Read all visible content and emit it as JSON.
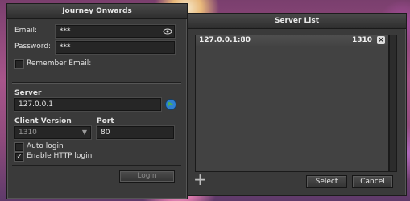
{
  "login_window": {
    "title": "Journey Onwards",
    "email_label": "Email:",
    "email_value": "***",
    "password_label": "Password:",
    "password_value": "***",
    "remember_email_label": "Remember Email:",
    "remember_email_checked": false,
    "server_label": "Server",
    "server_value": "127.0.0.1",
    "client_version_label": "Client Version",
    "client_version_value": "1310",
    "port_label": "Port",
    "port_value": "80",
    "auto_login_label": "Auto login",
    "auto_login_checked": false,
    "http_login_label": "Enable HTTP login",
    "http_login_checked": true,
    "http_login_mark": "✓",
    "login_button": "Login"
  },
  "server_list_window": {
    "title": "Server List",
    "servers": [
      {
        "address": "127.0.0.1:80",
        "version": "1310",
        "remove_glyph": "×"
      }
    ],
    "add_glyph": "+",
    "select_button": "Select",
    "cancel_button": "Cancel"
  },
  "icons": {
    "eye": "eye-icon",
    "globe": "globe-icon",
    "dropdown": "chevron-down-icon",
    "add": "plus-icon",
    "remove": "close-icon"
  }
}
